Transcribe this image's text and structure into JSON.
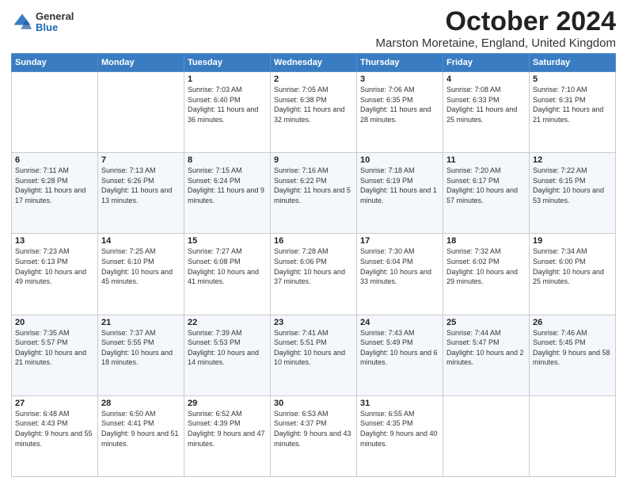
{
  "logo": {
    "general": "General",
    "blue": "Blue"
  },
  "title": "October 2024",
  "location": "Marston Moretaine, England, United Kingdom",
  "header_days": [
    "Sunday",
    "Monday",
    "Tuesday",
    "Wednesday",
    "Thursday",
    "Friday",
    "Saturday"
  ],
  "weeks": [
    [
      {
        "day": "",
        "info": ""
      },
      {
        "day": "",
        "info": ""
      },
      {
        "day": "1",
        "info": "Sunrise: 7:03 AM\nSunset: 6:40 PM\nDaylight: 11 hours and 36 minutes."
      },
      {
        "day": "2",
        "info": "Sunrise: 7:05 AM\nSunset: 6:38 PM\nDaylight: 11 hours and 32 minutes."
      },
      {
        "day": "3",
        "info": "Sunrise: 7:06 AM\nSunset: 6:35 PM\nDaylight: 11 hours and 28 minutes."
      },
      {
        "day": "4",
        "info": "Sunrise: 7:08 AM\nSunset: 6:33 PM\nDaylight: 11 hours and 25 minutes."
      },
      {
        "day": "5",
        "info": "Sunrise: 7:10 AM\nSunset: 6:31 PM\nDaylight: 11 hours and 21 minutes."
      }
    ],
    [
      {
        "day": "6",
        "info": "Sunrise: 7:11 AM\nSunset: 6:28 PM\nDaylight: 11 hours and 17 minutes."
      },
      {
        "day": "7",
        "info": "Sunrise: 7:13 AM\nSunset: 6:26 PM\nDaylight: 11 hours and 13 minutes."
      },
      {
        "day": "8",
        "info": "Sunrise: 7:15 AM\nSunset: 6:24 PM\nDaylight: 11 hours and 9 minutes."
      },
      {
        "day": "9",
        "info": "Sunrise: 7:16 AM\nSunset: 6:22 PM\nDaylight: 11 hours and 5 minutes."
      },
      {
        "day": "10",
        "info": "Sunrise: 7:18 AM\nSunset: 6:19 PM\nDaylight: 11 hours and 1 minute."
      },
      {
        "day": "11",
        "info": "Sunrise: 7:20 AM\nSunset: 6:17 PM\nDaylight: 10 hours and 57 minutes."
      },
      {
        "day": "12",
        "info": "Sunrise: 7:22 AM\nSunset: 6:15 PM\nDaylight: 10 hours and 53 minutes."
      }
    ],
    [
      {
        "day": "13",
        "info": "Sunrise: 7:23 AM\nSunset: 6:13 PM\nDaylight: 10 hours and 49 minutes."
      },
      {
        "day": "14",
        "info": "Sunrise: 7:25 AM\nSunset: 6:10 PM\nDaylight: 10 hours and 45 minutes."
      },
      {
        "day": "15",
        "info": "Sunrise: 7:27 AM\nSunset: 6:08 PM\nDaylight: 10 hours and 41 minutes."
      },
      {
        "day": "16",
        "info": "Sunrise: 7:28 AM\nSunset: 6:06 PM\nDaylight: 10 hours and 37 minutes."
      },
      {
        "day": "17",
        "info": "Sunrise: 7:30 AM\nSunset: 6:04 PM\nDaylight: 10 hours and 33 minutes."
      },
      {
        "day": "18",
        "info": "Sunrise: 7:32 AM\nSunset: 6:02 PM\nDaylight: 10 hours and 29 minutes."
      },
      {
        "day": "19",
        "info": "Sunrise: 7:34 AM\nSunset: 6:00 PM\nDaylight: 10 hours and 25 minutes."
      }
    ],
    [
      {
        "day": "20",
        "info": "Sunrise: 7:35 AM\nSunset: 5:57 PM\nDaylight: 10 hours and 21 minutes."
      },
      {
        "day": "21",
        "info": "Sunrise: 7:37 AM\nSunset: 5:55 PM\nDaylight: 10 hours and 18 minutes."
      },
      {
        "day": "22",
        "info": "Sunrise: 7:39 AM\nSunset: 5:53 PM\nDaylight: 10 hours and 14 minutes."
      },
      {
        "day": "23",
        "info": "Sunrise: 7:41 AM\nSunset: 5:51 PM\nDaylight: 10 hours and 10 minutes."
      },
      {
        "day": "24",
        "info": "Sunrise: 7:43 AM\nSunset: 5:49 PM\nDaylight: 10 hours and 6 minutes."
      },
      {
        "day": "25",
        "info": "Sunrise: 7:44 AM\nSunset: 5:47 PM\nDaylight: 10 hours and 2 minutes."
      },
      {
        "day": "26",
        "info": "Sunrise: 7:46 AM\nSunset: 5:45 PM\nDaylight: 9 hours and 58 minutes."
      }
    ],
    [
      {
        "day": "27",
        "info": "Sunrise: 6:48 AM\nSunset: 4:43 PM\nDaylight: 9 hours and 55 minutes."
      },
      {
        "day": "28",
        "info": "Sunrise: 6:50 AM\nSunset: 4:41 PM\nDaylight: 9 hours and 51 minutes."
      },
      {
        "day": "29",
        "info": "Sunrise: 6:52 AM\nSunset: 4:39 PM\nDaylight: 9 hours and 47 minutes."
      },
      {
        "day": "30",
        "info": "Sunrise: 6:53 AM\nSunset: 4:37 PM\nDaylight: 9 hours and 43 minutes."
      },
      {
        "day": "31",
        "info": "Sunrise: 6:55 AM\nSunset: 4:35 PM\nDaylight: 9 hours and 40 minutes."
      },
      {
        "day": "",
        "info": ""
      },
      {
        "day": "",
        "info": ""
      }
    ]
  ]
}
